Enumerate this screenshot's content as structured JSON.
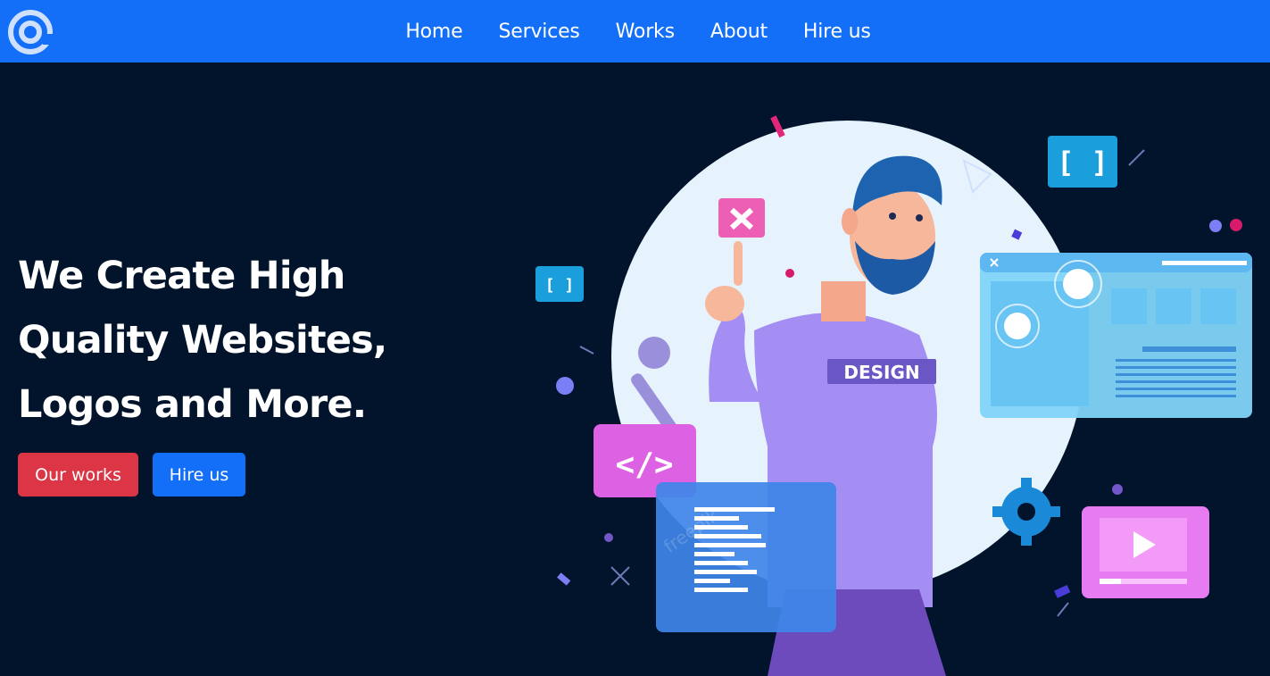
{
  "nav": {
    "logo_icon": "at-sign-icon",
    "links": [
      "Home",
      "Services",
      "Works",
      "About",
      "Hire us"
    ]
  },
  "hero": {
    "title_lines": [
      "We Create High",
      "Quality Websites,",
      "Logos and More."
    ],
    "primary_button": "Our works",
    "secondary_button": "Hire us",
    "illustration": {
      "shirt_text": "DESIGN",
      "code_tag": "</>",
      "bracket_label": "[ ]",
      "watermark": "freepik"
    }
  },
  "colors": {
    "nav_bg": "#136ff8",
    "page_bg": "#02142b",
    "primary_red": "#dc3545",
    "primary_blue": "#136ff8"
  }
}
